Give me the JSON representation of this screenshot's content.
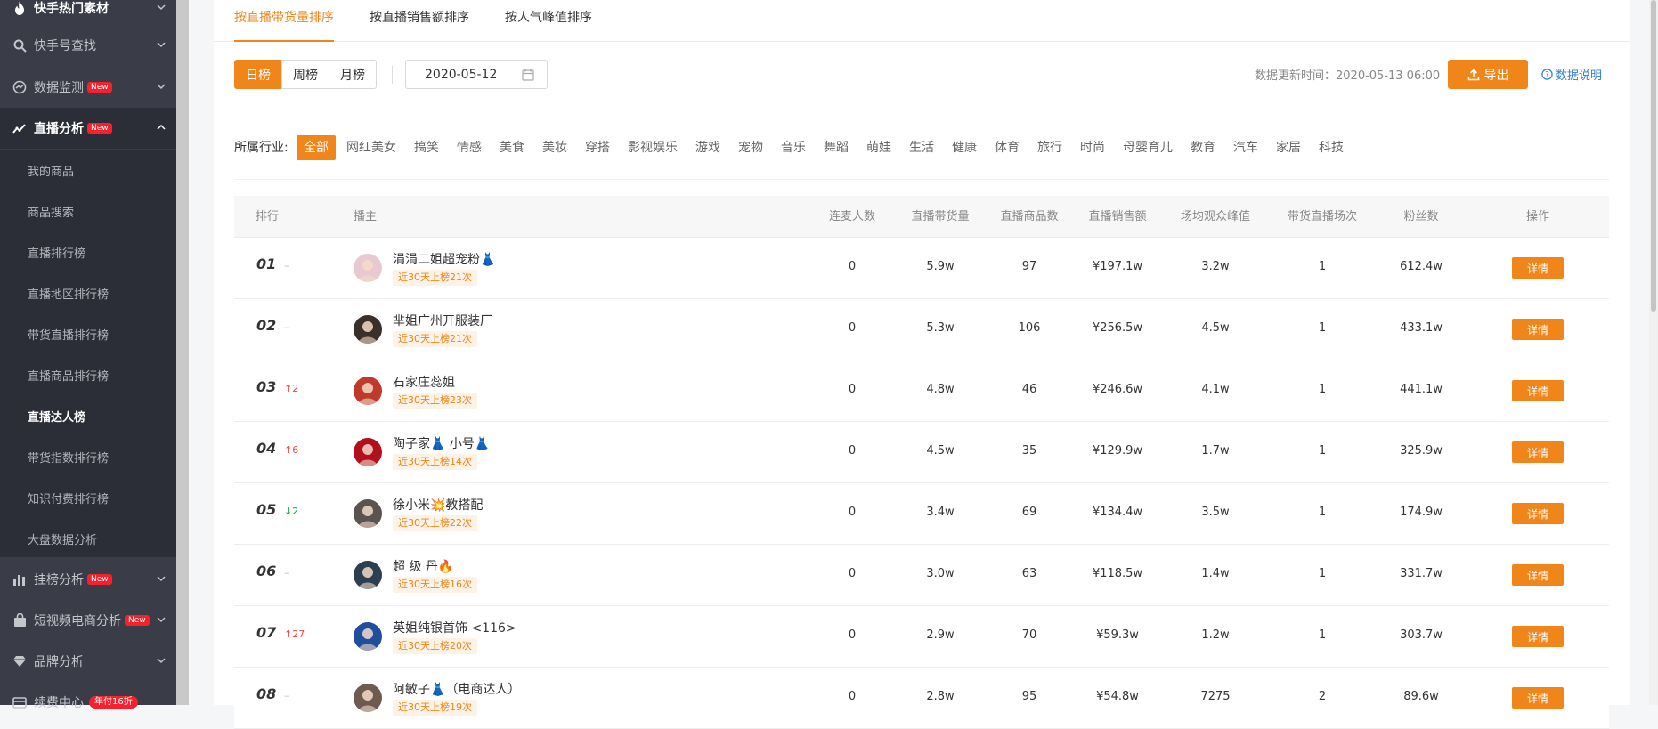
{
  "sidebar": {
    "items": [
      {
        "label": "快手热门素材",
        "icon": "fire-icon"
      },
      {
        "label": "快手号查找",
        "icon": "search-icon"
      },
      {
        "label": "数据监测",
        "icon": "monitor-icon",
        "badge": "New"
      },
      {
        "label": "直播分析",
        "icon": "trend-line-icon",
        "badge": "New",
        "expanded": true
      },
      {
        "label": "挂榜分析",
        "icon": "bar-chart-icon",
        "badge": "New"
      },
      {
        "label": "短视频电商分析",
        "icon": "bag-icon",
        "badge": "New"
      },
      {
        "label": "品牌分析",
        "icon": "diamond-icon"
      },
      {
        "label": "续费中心",
        "icon": "card-icon",
        "badge": "年付16折"
      }
    ],
    "sub_items": [
      "我的商品",
      "商品搜索",
      "直播排行榜",
      "直播地区排行榜",
      "带货直播排行榜",
      "直播商品排行榜",
      "直播达人榜",
      "带货指数排行榜",
      "知识付费排行榜",
      "大盘数据分析"
    ],
    "current_sub": "直播达人榜"
  },
  "tabs": [
    "按直播带货量排序",
    "按直播销售额排序",
    "按人气峰值排序"
  ],
  "toolbar": {
    "ranges": [
      "日榜",
      "周榜",
      "月榜"
    ],
    "date": "2020-05-12",
    "update_time": "数据更新时间：2020-05-13 06:00",
    "export_label": "导出",
    "note_label": "数据说明"
  },
  "industry": {
    "label": "所属行业:",
    "options": [
      "全部",
      "网红美女",
      "搞笑",
      "情感",
      "美食",
      "美妆",
      "穿搭",
      "影视娱乐",
      "游戏",
      "宠物",
      "音乐",
      "舞蹈",
      "萌娃",
      "生活",
      "健康",
      "体育",
      "旅行",
      "时尚",
      "母婴育儿",
      "教育",
      "汽车",
      "家居",
      "科技"
    ]
  },
  "table": {
    "headers": [
      "排行",
      "播主",
      "连麦人数",
      "直播带货量",
      "直播商品数",
      "直播销售额",
      "场均观众峰值",
      "带货直播场次",
      "粉丝数",
      "操作"
    ],
    "detail_label": "详情",
    "rows": [
      {
        "rank": "01",
        "trend": "–",
        "trend_type": "flat",
        "name": "涓涓二姐超宠粉👗",
        "chip": "近30天上榜21次",
        "lianmai": "0",
        "volume": "5.9w",
        "products": "97",
        "sales": "¥197.1w",
        "peak": "3.2w",
        "sessions": "1",
        "fans": "612.4w",
        "avatar_color": "#e8c9d2"
      },
      {
        "rank": "02",
        "trend": "–",
        "trend_type": "flat",
        "name": "芈姐广州开服装厂",
        "chip": "近30天上榜21次",
        "lianmai": "0",
        "volume": "5.3w",
        "products": "106",
        "sales": "¥256.5w",
        "peak": "4.5w",
        "sessions": "1",
        "fans": "433.1w",
        "avatar_color": "#3b2f2a"
      },
      {
        "rank": "03",
        "trend": "↑2",
        "trend_type": "up",
        "name": "石家庄蕊姐",
        "chip": "近30天上榜23次",
        "lianmai": "0",
        "volume": "4.8w",
        "products": "46",
        "sales": "¥246.6w",
        "peak": "4.1w",
        "sessions": "1",
        "fans": "441.1w",
        "avatar_color": "#c0392b"
      },
      {
        "rank": "04",
        "trend": "↑6",
        "trend_type": "up",
        "name": "陶子家👗 小号👗",
        "chip": "近30天上榜14次",
        "lianmai": "0",
        "volume": "4.5w",
        "products": "35",
        "sales": "¥129.9w",
        "peak": "1.7w",
        "sessions": "1",
        "fans": "325.9w",
        "avatar_color": "#b3101e"
      },
      {
        "rank": "05",
        "trend": "↓2",
        "trend_type": "down",
        "name": "徐小米💥教搭配",
        "chip": "近30天上榜22次",
        "lianmai": "0",
        "volume": "3.4w",
        "products": "69",
        "sales": "¥134.4w",
        "peak": "3.5w",
        "sessions": "1",
        "fans": "174.9w",
        "avatar_color": "#5a5350"
      },
      {
        "rank": "06",
        "trend": "–",
        "trend_type": "flat",
        "name": "超 级 丹🔥",
        "chip": "近30天上榜16次",
        "lianmai": "0",
        "volume": "3.0w",
        "products": "63",
        "sales": "¥118.5w",
        "peak": "1.4w",
        "sessions": "1",
        "fans": "331.7w",
        "avatar_color": "#2c3e50"
      },
      {
        "rank": "07",
        "trend": "↑27",
        "trend_type": "up",
        "name": "英姐纯银首饰 <116>",
        "chip": "近30天上榜20次",
        "lianmai": "0",
        "volume": "2.9w",
        "products": "70",
        "sales": "¥59.3w",
        "peak": "1.2w",
        "sessions": "1",
        "fans": "303.7w",
        "avatar_color": "#1f4e9c"
      },
      {
        "rank": "08",
        "trend": "–",
        "trend_type": "flat",
        "name": "阿敏子👗（电商达人）",
        "chip": "近30天上榜19次",
        "lianmai": "0",
        "volume": "2.8w",
        "products": "95",
        "sales": "¥54.8w",
        "peak": "7275",
        "sessions": "2",
        "fans": "89.6w",
        "avatar_color": "#6e5a50"
      }
    ]
  }
}
